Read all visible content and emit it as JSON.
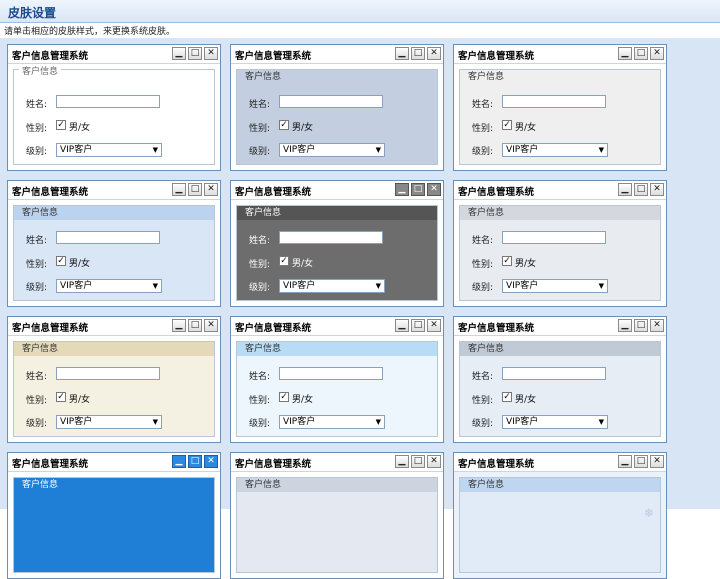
{
  "header": {
    "title": "皮肤设置",
    "instruction": "请单击相应的皮肤样式，来更换系统皮肤。"
  },
  "window": {
    "title": "客户信息管理系统",
    "btn_min": "▁",
    "btn_max": "□",
    "btn_close": "✕",
    "group_title": "客户信息",
    "name_label": "姓名:",
    "name_value": "",
    "gender_label": "性别:",
    "gender_checkbox": "✓",
    "gender_option": "男/女",
    "level_label": "级别:",
    "level_value": "VIP客户",
    "dropdown_arrow": "▼"
  },
  "skins": [
    "skin-1",
    "skin-2",
    "skin-3",
    "skin-4",
    "skin-5",
    "skin-6",
    "skin-7",
    "skin-8",
    "skin-9",
    "skin-10",
    "skin-11",
    "skin-12"
  ]
}
